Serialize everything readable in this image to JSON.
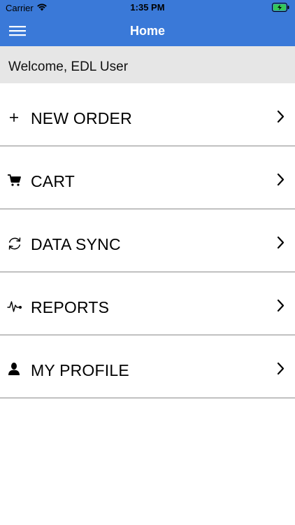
{
  "status_bar": {
    "carrier": "Carrier",
    "time": "1:35 PM",
    "wifi_icon": "wifi-icon",
    "battery_icon": "battery-charging-icon"
  },
  "nav": {
    "title": "Home",
    "menu_icon": "hamburger-menu-icon",
    "bar_color": "#3a79d8"
  },
  "welcome": {
    "text": "Welcome, EDL User",
    "background": "#e6e6e6"
  },
  "menu": {
    "items": [
      {
        "label": "NEW ORDER",
        "icon": "plus-icon"
      },
      {
        "label": "CART",
        "icon": "cart-icon"
      },
      {
        "label": "DATA SYNC",
        "icon": "sync-icon"
      },
      {
        "label": "REPORTS",
        "icon": "pulse-icon"
      },
      {
        "label": "MY PROFILE",
        "icon": "user-icon"
      }
    ],
    "chevron_icon": "chevron-right-icon"
  }
}
